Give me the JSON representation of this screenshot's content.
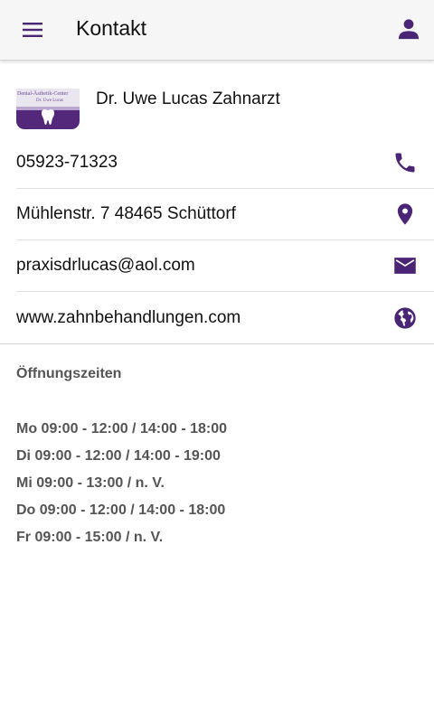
{
  "appbar": {
    "title": "Kontakt",
    "menu_icon": "menu-icon",
    "profile_icon": "person-icon"
  },
  "colors": {
    "accent": "#4a2575",
    "appbar_bg": "#f6f6f6",
    "text_muted": "#555555"
  },
  "clinic": {
    "name": "Dr. Uwe Lucas Zahnarzt",
    "logo_text_1": "Dental-Ästhetik-Center",
    "logo_text_2": "Dr. Uwe Lucas"
  },
  "contacts": [
    {
      "text": "05923-71323",
      "icon": "phone-icon"
    },
    {
      "text": "Mühlenstr. 7 48465 Schüttorf",
      "icon": "location-pin-icon"
    },
    {
      "text": "praxisdrlucas@aol.com",
      "icon": "mail-icon"
    },
    {
      "text": "www.zahnbehandlungen.com",
      "icon": "globe-icon"
    }
  ],
  "hours": {
    "title": "Öffnungszeiten",
    "lines": [
      "Mo 09:00 - 12:00 / 14:00 - 18:00",
      "Di 09:00 - 12:00 / 14:00 - 19:00",
      "Mi 09:00 - 13:00 / n. V.",
      "Do 09:00 - 12:00 / 14:00 - 18:00",
      "Fr 09:00 - 15:00 / n. V."
    ]
  }
}
